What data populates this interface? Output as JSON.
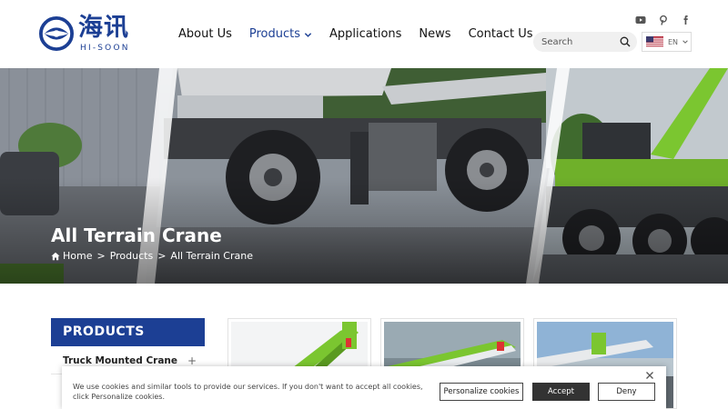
{
  "brand": {
    "name_cn": "海讯",
    "name_en": "HI-SOON",
    "primary_color": "#1c3f94",
    "accent_green": "#7bc630"
  },
  "nav": {
    "items": [
      {
        "label": "About Us"
      },
      {
        "label": "Products",
        "active": true,
        "has_dropdown": true
      },
      {
        "label": "Applications"
      },
      {
        "label": "News"
      },
      {
        "label": "Contact Us"
      }
    ]
  },
  "social": {
    "icons": [
      "youtube-icon",
      "pinterest-icon",
      "facebook-icon"
    ]
  },
  "search": {
    "placeholder": "Search",
    "icon": "search-icon"
  },
  "language": {
    "code": "EN",
    "flag": "us-flag-icon"
  },
  "banner": {
    "title": "All Terrain Crane",
    "breadcrumb": [
      "Home",
      "Products",
      "All Terrain Crane"
    ],
    "separator": ">"
  },
  "sidebar": {
    "heading": "PRODUCTS",
    "items": [
      {
        "label": "Truck Mounted Crane",
        "expand": "+"
      }
    ]
  },
  "products": [
    {
      "image": "crane-product-1"
    },
    {
      "image": "crane-product-2"
    },
    {
      "image": "crane-product-3"
    }
  ],
  "cookie": {
    "text": "We use cookies and similar tools to provide our services. If you don't want to accept all cookies, click Personalize cookies.",
    "personalize_label": "Personalize cookies",
    "accept_label": "Accept",
    "deny_label": "Deny"
  }
}
